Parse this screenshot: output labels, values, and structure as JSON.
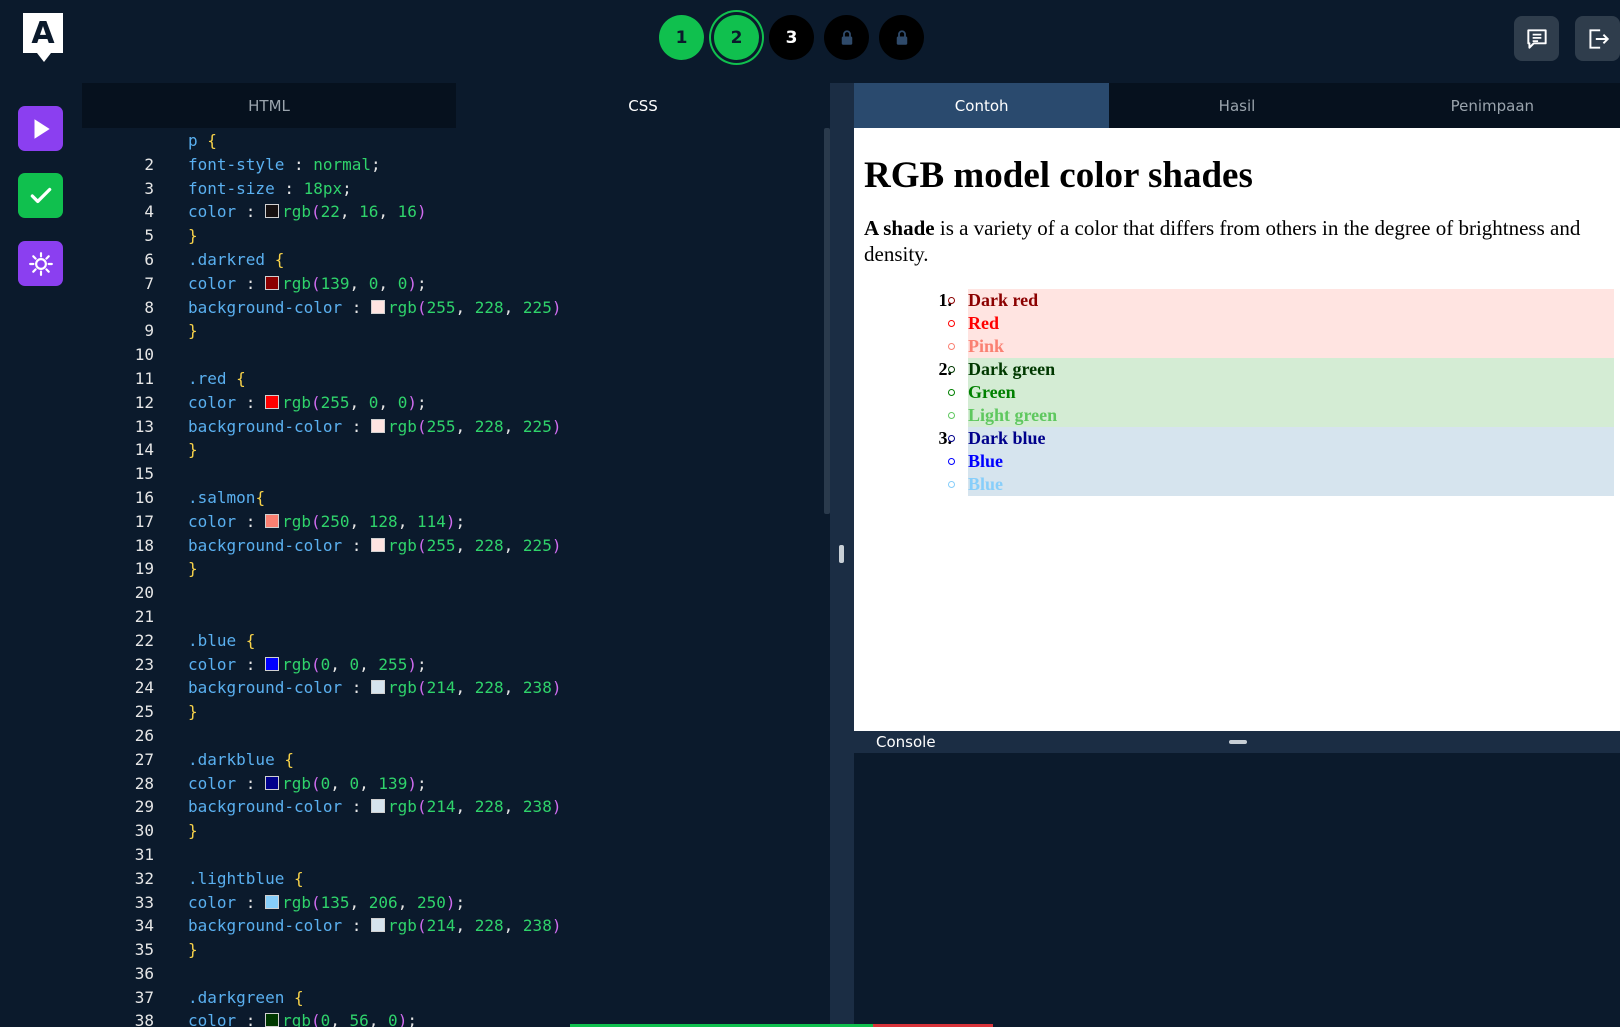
{
  "topbar": {
    "logo_letter": "A",
    "steps": [
      {
        "label": "1",
        "state": "done"
      },
      {
        "label": "2",
        "state": "current"
      },
      {
        "label": "3",
        "state": "open"
      },
      {
        "label": "",
        "state": "locked"
      },
      {
        "label": "",
        "state": "locked"
      }
    ],
    "icons": [
      "chat-icon",
      "logout-icon"
    ]
  },
  "rail": {
    "buttons": [
      "play-icon",
      "check-icon",
      "sun-icon"
    ],
    "colors": {
      "purple": "#8b3ff0",
      "green": "#10c04e"
    }
  },
  "editor": {
    "tabs": [
      {
        "label": "HTML"
      },
      {
        "label": "CSS"
      }
    ],
    "active_tab": "CSS",
    "lines": [
      {
        "n": "",
        "tokens": [
          [
            "sel",
            "p "
          ],
          [
            "brace",
            "{"
          ]
        ]
      },
      {
        "n": "2",
        "tokens": [
          [
            "prop",
            "font-style "
          ],
          [
            "punc",
            ": "
          ],
          [
            "val",
            "normal"
          ],
          [
            "punc",
            ";"
          ]
        ]
      },
      {
        "n": "3",
        "tokens": [
          [
            "prop",
            "font-size "
          ],
          [
            "punc",
            ": "
          ],
          [
            "val",
            "18px"
          ],
          [
            "punc",
            ";"
          ]
        ]
      },
      {
        "n": "4",
        "tokens": [
          [
            "prop",
            "color "
          ],
          [
            "punc",
            ": "
          ],
          [
            "swatch",
            "#161010"
          ],
          [
            "val",
            "rgb"
          ],
          [
            "paren",
            "("
          ],
          [
            "val",
            "22"
          ],
          [
            "punc",
            ", "
          ],
          [
            "val",
            "16"
          ],
          [
            "punc",
            ", "
          ],
          [
            "val",
            "16"
          ],
          [
            "paren",
            ")"
          ]
        ]
      },
      {
        "n": "5",
        "tokens": [
          [
            "brace",
            "}"
          ]
        ]
      },
      {
        "n": "6",
        "tokens": [
          [
            "sel",
            ".darkred "
          ],
          [
            "brace",
            "{"
          ]
        ]
      },
      {
        "n": "7",
        "tokens": [
          [
            "prop",
            "color "
          ],
          [
            "punc",
            ": "
          ],
          [
            "swatch",
            "#8b0000"
          ],
          [
            "val",
            "rgb"
          ],
          [
            "paren",
            "("
          ],
          [
            "val",
            "139"
          ],
          [
            "punc",
            ", "
          ],
          [
            "val",
            "0"
          ],
          [
            "punc",
            ", "
          ],
          [
            "val",
            "0"
          ],
          [
            "paren",
            ")"
          ],
          [
            "punc",
            ";"
          ]
        ]
      },
      {
        "n": "8",
        "tokens": [
          [
            "prop",
            "background-color "
          ],
          [
            "punc",
            ": "
          ],
          [
            "swatch",
            "#ffe4e1"
          ],
          [
            "val",
            "rgb"
          ],
          [
            "paren",
            "("
          ],
          [
            "val",
            "255"
          ],
          [
            "punc",
            ", "
          ],
          [
            "val",
            "228"
          ],
          [
            "punc",
            ", "
          ],
          [
            "val",
            "225"
          ],
          [
            "paren",
            ")"
          ]
        ]
      },
      {
        "n": "9",
        "tokens": [
          [
            "brace",
            "}"
          ]
        ]
      },
      {
        "n": "10",
        "tokens": []
      },
      {
        "n": "11",
        "tokens": [
          [
            "sel",
            ".red "
          ],
          [
            "brace",
            "{"
          ]
        ]
      },
      {
        "n": "12",
        "tokens": [
          [
            "prop",
            "color "
          ],
          [
            "punc",
            ": "
          ],
          [
            "swatch",
            "#ff0000"
          ],
          [
            "val",
            "rgb"
          ],
          [
            "paren",
            "("
          ],
          [
            "val",
            "255"
          ],
          [
            "punc",
            ", "
          ],
          [
            "val",
            "0"
          ],
          [
            "punc",
            ", "
          ],
          [
            "val",
            "0"
          ],
          [
            "paren",
            ")"
          ],
          [
            "punc",
            ";"
          ]
        ]
      },
      {
        "n": "13",
        "tokens": [
          [
            "prop",
            "background-color "
          ],
          [
            "punc",
            ": "
          ],
          [
            "swatch",
            "#ffe4e1"
          ],
          [
            "val",
            "rgb"
          ],
          [
            "paren",
            "("
          ],
          [
            "val",
            "255"
          ],
          [
            "punc",
            ", "
          ],
          [
            "val",
            "228"
          ],
          [
            "punc",
            ", "
          ],
          [
            "val",
            "225"
          ],
          [
            "paren",
            ")"
          ]
        ]
      },
      {
        "n": "14",
        "tokens": [
          [
            "brace",
            "}"
          ]
        ]
      },
      {
        "n": "15",
        "tokens": []
      },
      {
        "n": "16",
        "tokens": [
          [
            "sel",
            ".salmon"
          ],
          [
            "brace",
            "{"
          ]
        ]
      },
      {
        "n": "17",
        "tokens": [
          [
            "prop",
            "color "
          ],
          [
            "punc",
            ": "
          ],
          [
            "swatch",
            "#fa8072"
          ],
          [
            "val",
            "rgb"
          ],
          [
            "paren",
            "("
          ],
          [
            "val",
            "250"
          ],
          [
            "punc",
            ", "
          ],
          [
            "val",
            "128"
          ],
          [
            "punc",
            ", "
          ],
          [
            "val",
            "114"
          ],
          [
            "paren",
            ")"
          ],
          [
            "punc",
            ";"
          ]
        ]
      },
      {
        "n": "18",
        "tokens": [
          [
            "prop",
            "background-color "
          ],
          [
            "punc",
            ": "
          ],
          [
            "swatch",
            "#ffe4e1"
          ],
          [
            "val",
            "rgb"
          ],
          [
            "paren",
            "("
          ],
          [
            "val",
            "255"
          ],
          [
            "punc",
            ", "
          ],
          [
            "val",
            "228"
          ],
          [
            "punc",
            ", "
          ],
          [
            "val",
            "225"
          ],
          [
            "paren",
            ")"
          ]
        ]
      },
      {
        "n": "19",
        "tokens": [
          [
            "brace",
            "}"
          ]
        ]
      },
      {
        "n": "20",
        "tokens": []
      },
      {
        "n": "21",
        "tokens": []
      },
      {
        "n": "22",
        "tokens": [
          [
            "sel",
            ".blue "
          ],
          [
            "brace",
            "{"
          ]
        ]
      },
      {
        "n": "23",
        "tokens": [
          [
            "prop",
            "color "
          ],
          [
            "punc",
            ": "
          ],
          [
            "swatch",
            "#0000ff"
          ],
          [
            "val",
            "rgb"
          ],
          [
            "paren",
            "("
          ],
          [
            "val",
            "0"
          ],
          [
            "punc",
            ", "
          ],
          [
            "val",
            "0"
          ],
          [
            "punc",
            ", "
          ],
          [
            "val",
            "255"
          ],
          [
            "paren",
            ")"
          ],
          [
            "punc",
            ";"
          ]
        ]
      },
      {
        "n": "24",
        "tokens": [
          [
            "prop",
            "background-color "
          ],
          [
            "punc",
            ": "
          ],
          [
            "swatch",
            "#d6e4ee"
          ],
          [
            "val",
            "rgb"
          ],
          [
            "paren",
            "("
          ],
          [
            "val",
            "214"
          ],
          [
            "punc",
            ", "
          ],
          [
            "val",
            "228"
          ],
          [
            "punc",
            ", "
          ],
          [
            "val",
            "238"
          ],
          [
            "paren",
            ")"
          ]
        ]
      },
      {
        "n": "25",
        "tokens": [
          [
            "brace",
            "}"
          ]
        ]
      },
      {
        "n": "26",
        "tokens": []
      },
      {
        "n": "27",
        "tokens": [
          [
            "sel",
            ".darkblue "
          ],
          [
            "brace",
            "{"
          ]
        ]
      },
      {
        "n": "28",
        "tokens": [
          [
            "prop",
            "color "
          ],
          [
            "punc",
            ": "
          ],
          [
            "swatch",
            "#00008b"
          ],
          [
            "val",
            "rgb"
          ],
          [
            "paren",
            "("
          ],
          [
            "val",
            "0"
          ],
          [
            "punc",
            ", "
          ],
          [
            "val",
            "0"
          ],
          [
            "punc",
            ", "
          ],
          [
            "val",
            "139"
          ],
          [
            "paren",
            ")"
          ],
          [
            "punc",
            ";"
          ]
        ]
      },
      {
        "n": "29",
        "tokens": [
          [
            "prop",
            "background-color "
          ],
          [
            "punc",
            ": "
          ],
          [
            "swatch",
            "#d6e4ee"
          ],
          [
            "val",
            "rgb"
          ],
          [
            "paren",
            "("
          ],
          [
            "val",
            "214"
          ],
          [
            "punc",
            ", "
          ],
          [
            "val",
            "228"
          ],
          [
            "punc",
            ", "
          ],
          [
            "val",
            "238"
          ],
          [
            "paren",
            ")"
          ]
        ]
      },
      {
        "n": "30",
        "tokens": [
          [
            "brace",
            "}"
          ]
        ]
      },
      {
        "n": "31",
        "tokens": []
      },
      {
        "n": "32",
        "tokens": [
          [
            "sel",
            ".lightblue "
          ],
          [
            "brace",
            "{"
          ]
        ]
      },
      {
        "n": "33",
        "tokens": [
          [
            "prop",
            "color "
          ],
          [
            "punc",
            ": "
          ],
          [
            "swatch",
            "#87cefa"
          ],
          [
            "val",
            "rgb"
          ],
          [
            "paren",
            "("
          ],
          [
            "val",
            "135"
          ],
          [
            "punc",
            ", "
          ],
          [
            "val",
            "206"
          ],
          [
            "punc",
            ", "
          ],
          [
            "val",
            "250"
          ],
          [
            "paren",
            ")"
          ],
          [
            "punc",
            ";"
          ]
        ]
      },
      {
        "n": "34",
        "tokens": [
          [
            "prop",
            "background-color "
          ],
          [
            "punc",
            ": "
          ],
          [
            "swatch",
            "#d6e4ee"
          ],
          [
            "val",
            "rgb"
          ],
          [
            "paren",
            "("
          ],
          [
            "val",
            "214"
          ],
          [
            "punc",
            ", "
          ],
          [
            "val",
            "228"
          ],
          [
            "punc",
            ", "
          ],
          [
            "val",
            "238"
          ],
          [
            "paren",
            ")"
          ]
        ]
      },
      {
        "n": "35",
        "tokens": [
          [
            "brace",
            "}"
          ]
        ]
      },
      {
        "n": "36",
        "tokens": []
      },
      {
        "n": "37",
        "tokens": [
          [
            "sel",
            ".darkgreen "
          ],
          [
            "brace",
            "{"
          ]
        ]
      },
      {
        "n": "38",
        "tokens": [
          [
            "prop",
            "color "
          ],
          [
            "punc",
            ": "
          ],
          [
            "swatch",
            "#003800"
          ],
          [
            "val",
            "rgb"
          ],
          [
            "paren",
            "("
          ],
          [
            "val",
            "0"
          ],
          [
            "punc",
            ", "
          ],
          [
            "val",
            "56"
          ],
          [
            "punc",
            ", "
          ],
          [
            "val",
            "0"
          ],
          [
            "paren",
            ")"
          ],
          [
            "punc",
            ";"
          ]
        ]
      }
    ]
  },
  "preview": {
    "tabs": [
      {
        "label": "Contoh"
      },
      {
        "label": "Hasil"
      },
      {
        "label": "Penimpaan"
      }
    ],
    "active_tab": "Contoh",
    "heading": "RGB model color shades",
    "intro_bold": "A shade",
    "intro_rest": " is a variety of a color that differs from others in the degree of brightness and density.",
    "groups": [
      {
        "num": "1.",
        "bg": "#ffe4e1",
        "items": [
          {
            "text": "Dark red",
            "color": "#8b0000"
          },
          {
            "text": "Red",
            "color": "#ff0000"
          },
          {
            "text": "Pink",
            "color": "#fa8072"
          }
        ]
      },
      {
        "num": "2.",
        "bg": "#d4ecd4",
        "items": [
          {
            "text": "Dark green",
            "color": "#003800"
          },
          {
            "text": "Green",
            "color": "#008000"
          },
          {
            "text": "Light green",
            "color": "#5fc85f"
          }
        ]
      },
      {
        "num": "3.",
        "bg": "#d6e4ee",
        "items": [
          {
            "text": "Dark blue",
            "color": "#00008b"
          },
          {
            "text": "Blue",
            "color": "#0000ff"
          },
          {
            "text": "Blue",
            "color": "#87cefa"
          }
        ]
      }
    ],
    "console_label": "Console"
  }
}
